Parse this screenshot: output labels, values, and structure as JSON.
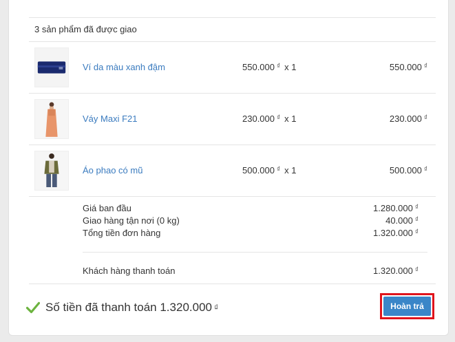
{
  "order": {
    "delivered_summary": "3 sản phẩm đã được giao",
    "currency_symbol": "₫",
    "items": [
      {
        "name": "Ví da màu xanh đậm",
        "unit_price": "550.000",
        "qty": "x 1",
        "total": "550.000",
        "thumb_icon": "wallet-thumbnail"
      },
      {
        "name": "Váy Maxi F21",
        "unit_price": "230.000",
        "qty": "x 1",
        "total": "230.000",
        "thumb_icon": "dress-thumbnail"
      },
      {
        "name": "Áo phao có mũ",
        "unit_price": "500.000",
        "qty": "x 1",
        "total": "500.000",
        "thumb_icon": "jacket-thumbnail"
      }
    ],
    "summary": {
      "original_label": "Giá ban đầu",
      "original_value": "1.280.000",
      "shipping_label": "Giao hàng tận nơi (0 kg)",
      "shipping_value": "40.000",
      "total_label": "Tổng tiền đơn hàng",
      "total_value": "1.320.000",
      "customer_paid_label": "Khách hàng thanh toán",
      "customer_paid_value": "1.320.000"
    },
    "paid_status": {
      "text": "Số tiền đã thanh toán 1.320.000",
      "icon": "check-icon",
      "icon_color": "#6cb33f"
    },
    "refund_button_label": "Hoàn trả"
  }
}
